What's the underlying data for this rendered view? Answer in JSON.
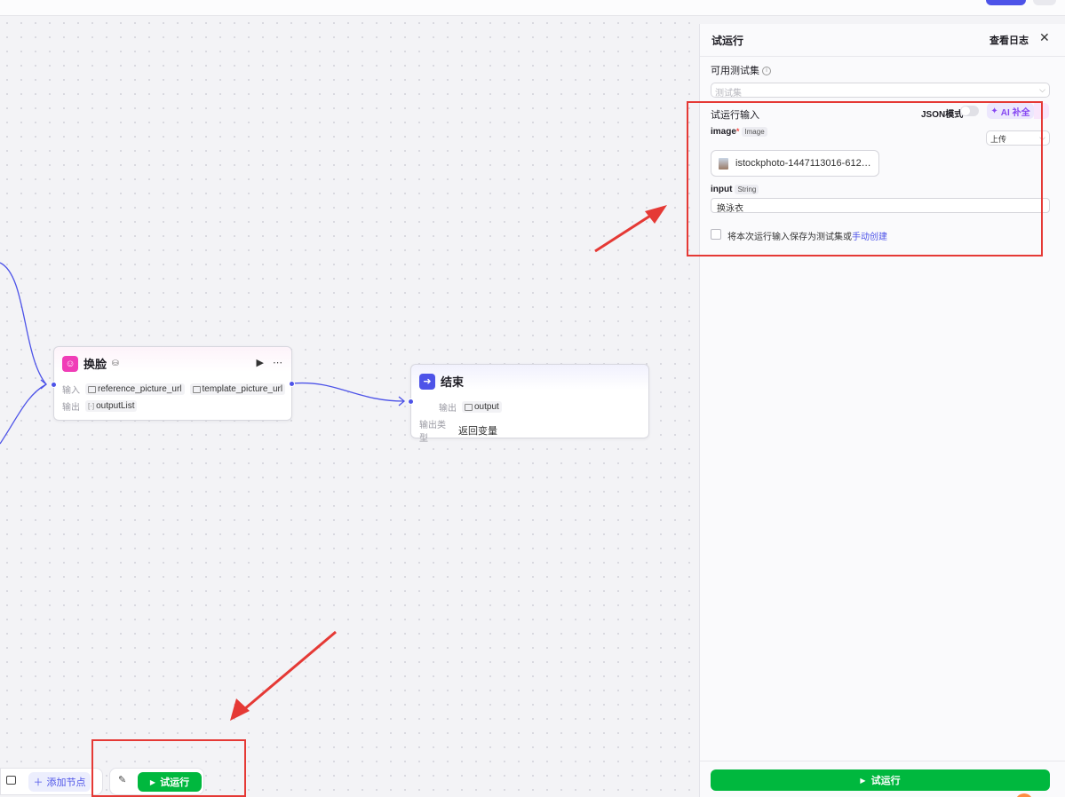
{
  "colors": {
    "accent": "#4d53e8",
    "run_green": "#00b83e",
    "annotation_red": "#e53935",
    "faceswap_icon": "#f03db7",
    "ai_purple": "#8647f2"
  },
  "canvas": {
    "faceswap_node": {
      "title": "换脸",
      "icon": "face-icon",
      "input_label": "输入",
      "inputs": [
        "reference_picture_url",
        "template_picture_url"
      ],
      "output_label": "输出",
      "output": "outputList"
    },
    "end_node": {
      "title": "结束",
      "icon": "exit-icon",
      "output_label": "输出",
      "output": "output",
      "output_type_label": "输出类型",
      "output_type": "返回变量"
    }
  },
  "toolbar": {
    "add_node_label": "添加节点",
    "run_label": "试运行"
  },
  "panel": {
    "title": "试运行",
    "view_log": "查看日志",
    "close_icon": "close-icon",
    "testset_label": "可用测试集",
    "testset_placeholder": "测试集",
    "run_input_label": "试运行输入",
    "json_mode_label": "JSON模式",
    "json_mode_on": false,
    "ai_fill_label": "AI 补全",
    "image_field": {
      "name": "image",
      "type": "Image",
      "required": true,
      "source_select": "上传",
      "file_name": "istockphoto-1447113016-612…"
    },
    "input_field": {
      "name": "input",
      "type": "String",
      "value": "换泳衣"
    },
    "save_text": "将本次运行输入保存为测试集或",
    "save_link": "手动创建",
    "run_button": "试运行"
  }
}
